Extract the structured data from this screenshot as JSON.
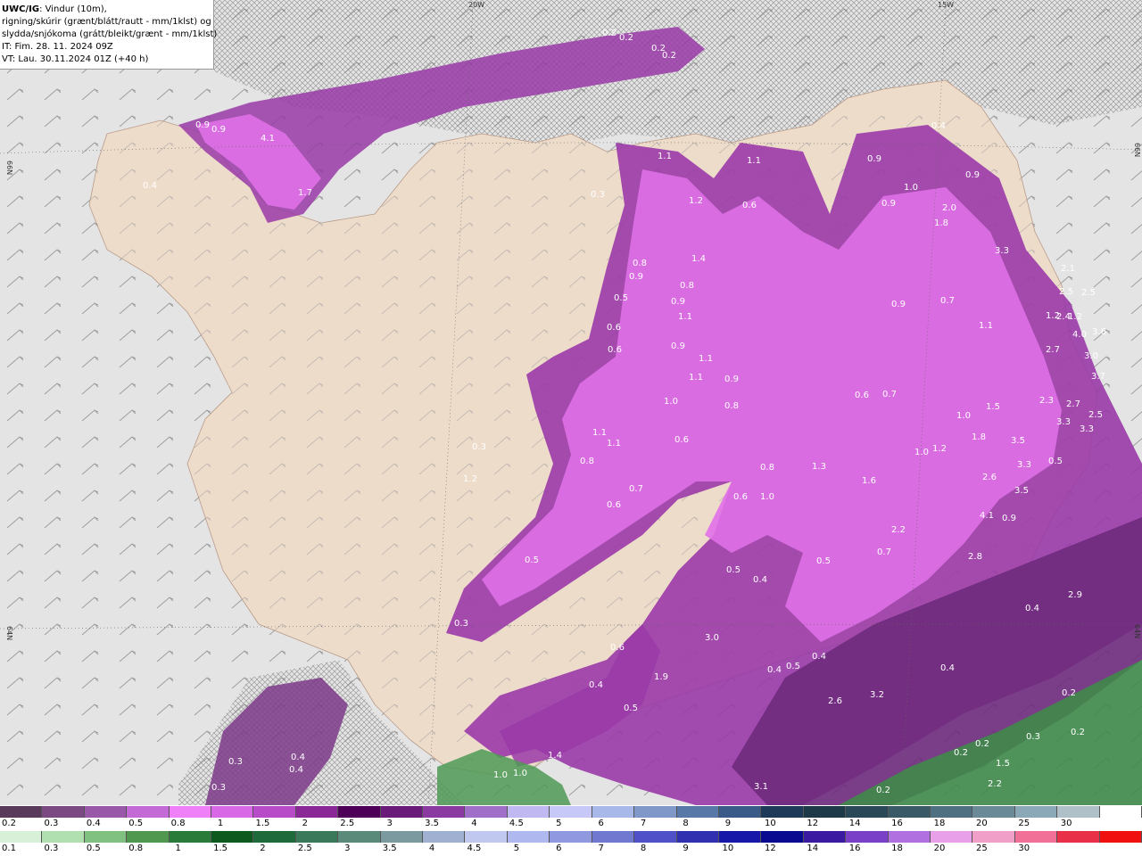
{
  "header": {
    "model": "UWC/IG",
    "desc_1": ": Vindur (10m),",
    "desc_2": "rigning/skúrir (grænt/blátt/rautt - mm/1klst) og",
    "desc_3": "slydda/snjókoma (grátt/bleikt/grænt - mm/1klst)",
    "init_time": "IT: Fim. 28. 11. 2024 09Z",
    "valid_time": "VT: Lau. 30.11.2024 01Z (+40 h)"
  },
  "graticule": {
    "lon_20w": "20W",
    "lon_15w": "15W",
    "lat_66n_left": "66N",
    "lat_66n_right": "66N",
    "lat_64n_left": "64N",
    "lat_64n_right": "64N"
  },
  "colors": {
    "land": "#eedccb",
    "sea": "#d9d9d9",
    "snow_pink": "#e070e8",
    "snow_purple": "#9a3aa8",
    "snow_dark": "#5a1c64",
    "rain_green": "#3f8a4a"
  },
  "precip_labels": [
    {
      "v": "0.2"
    },
    {
      "v": "0.2"
    },
    {
      "v": "0.2"
    },
    {
      "v": "0.2"
    },
    {
      "v": "0.9"
    },
    {
      "v": "0.9"
    },
    {
      "v": "4.1"
    },
    {
      "v": "1.7"
    },
    {
      "v": "0.4"
    },
    {
      "v": "0.4"
    },
    {
      "v": "1.1"
    },
    {
      "v": "1.1"
    },
    {
      "v": "0.9"
    },
    {
      "v": "1.0"
    },
    {
      "v": "0.9"
    },
    {
      "v": "0.3"
    },
    {
      "v": "1.2"
    },
    {
      "v": "0.6"
    },
    {
      "v": "0.9"
    },
    {
      "v": "2.0"
    },
    {
      "v": "1.8"
    },
    {
      "v": "3.3"
    },
    {
      "v": "2.1"
    },
    {
      "v": "2.5"
    },
    {
      "v": "2.5"
    },
    {
      "v": "1.4"
    },
    {
      "v": "0.8"
    },
    {
      "v": "0.9"
    },
    {
      "v": "0.5"
    },
    {
      "v": "0.6"
    },
    {
      "v": "0.6"
    },
    {
      "v": "1.2"
    },
    {
      "v": "1.2"
    },
    {
      "v": "0.9"
    },
    {
      "v": "0.7"
    },
    {
      "v": "1.1"
    },
    {
      "v": "2.4"
    },
    {
      "v": "4.0"
    },
    {
      "v": "3.6"
    },
    {
      "v": "2.7"
    },
    {
      "v": "3.0"
    },
    {
      "v": "3.7"
    },
    {
      "v": "0.9"
    },
    {
      "v": "0.8"
    },
    {
      "v": "1.1"
    },
    {
      "v": "1.1"
    },
    {
      "v": "0.9"
    },
    {
      "v": "0.9"
    },
    {
      "v": "1.0"
    },
    {
      "v": "0.8"
    },
    {
      "v": "1.1"
    },
    {
      "v": "0.6"
    },
    {
      "v": "0.7"
    },
    {
      "v": "1.0"
    },
    {
      "v": "1.5"
    },
    {
      "v": "2.3"
    },
    {
      "v": "2.7"
    },
    {
      "v": "3.3"
    },
    {
      "v": "3.3"
    },
    {
      "v": "2.5"
    },
    {
      "v": "0.3"
    },
    {
      "v": "1.2"
    },
    {
      "v": "1.1"
    },
    {
      "v": "1.1"
    },
    {
      "v": "0.8"
    },
    {
      "v": "0.6"
    },
    {
      "v": "0.8"
    },
    {
      "v": "1.3"
    },
    {
      "v": "1.0"
    },
    {
      "v": "1.2"
    },
    {
      "v": "1.8"
    },
    {
      "v": "3.5"
    },
    {
      "v": "3.3"
    },
    {
      "v": "0.5"
    },
    {
      "v": "0.7"
    },
    {
      "v": "0.6"
    },
    {
      "v": "0.6"
    },
    {
      "v": "1.0"
    },
    {
      "v": "1.6"
    },
    {
      "v": "2.6"
    },
    {
      "v": "3.5"
    },
    {
      "v": "4.1"
    },
    {
      "v": "0.9"
    },
    {
      "v": "0.5"
    },
    {
      "v": "0.5"
    },
    {
      "v": "0.4"
    },
    {
      "v": "0.5"
    },
    {
      "v": "0.7"
    },
    {
      "v": "2.2"
    },
    {
      "v": "2.8"
    },
    {
      "v": "2.9"
    },
    {
      "v": "0.4"
    },
    {
      "v": "0.3"
    },
    {
      "v": "0.6"
    },
    {
      "v": "3.0"
    },
    {
      "v": "0.4"
    },
    {
      "v": "0.4"
    },
    {
      "v": "0.5"
    },
    {
      "v": "1.9"
    },
    {
      "v": "0.4"
    },
    {
      "v": "0.4"
    },
    {
      "v": "0.5"
    },
    {
      "v": "2.6"
    },
    {
      "v": "3.2"
    },
    {
      "v": "1.4"
    },
    {
      "v": "0.3"
    },
    {
      "v": "0.3"
    },
    {
      "v": "0.4"
    },
    {
      "v": "0.4"
    },
    {
      "v": "1.0"
    },
    {
      "v": "1.0"
    },
    {
      "v": "3.1"
    },
    {
      "v": "0.2"
    },
    {
      "v": "0.2"
    },
    {
      "v": "0.2"
    },
    {
      "v": "0.3"
    },
    {
      "v": "0.2"
    },
    {
      "v": "1.5"
    },
    {
      "v": "2.2"
    },
    {
      "v": "0.2"
    }
  ],
  "legend_snow": {
    "colors": [
      "#5a3a5a",
      "#7c4a82",
      "#9a58a8",
      "#c46ad6",
      "#f080f8",
      "#d868e6",
      "#b84cc8",
      "#8a2898",
      "#4e0058",
      "#6a1a78",
      "#8a3aa0",
      "#a070c8",
      "#c0b8f0",
      "#c8c8f8",
      "#a8b8e8",
      "#8098c8",
      "#5878a8",
      "#3a5a88",
      "#1e3a58",
      "#1e3a48",
      "#2a4858",
      "#3a5a68",
      "#4e7080",
      "#6a8a98",
      "#8aa8b8",
      "#b0c0c8",
      "#ffffff"
    ],
    "ticks": [
      "0.2",
      "0.3",
      "0.4",
      "0.5",
      "0.8",
      "1",
      "1.5",
      "2",
      "2.5",
      "3",
      "3.5",
      "4",
      "4.5",
      "5",
      "6",
      "7",
      "8",
      "9",
      "10",
      "12",
      "14",
      "16",
      "18",
      "20",
      "25",
      "30"
    ]
  },
  "legend_rain": {
    "colors": [
      "#d8f0d8",
      "#b0e0b0",
      "#80c080",
      "#509850",
      "#2a7a3a",
      "#0e5a1e",
      "#1e6a3a",
      "#3a7a5a",
      "#5a8a7a",
      "#7a9aa0",
      "#a0b0d0",
      "#c0c8f0",
      "#b0b8f0",
      "#9098e0",
      "#7078d0",
      "#5050c8",
      "#3030b0",
      "#1818a8",
      "#0a0a90",
      "#3a1aa0",
      "#7a40c8",
      "#b070e0",
      "#e8a0e8",
      "#f0a0c8",
      "#f07098",
      "#e83048",
      "#f01010"
    ],
    "ticks": [
      "0.1",
      "0.3",
      "0.5",
      "0.8",
      "1",
      "1.5",
      "2",
      "2.5",
      "3",
      "3.5",
      "4",
      "4.5",
      "5",
      "6",
      "7",
      "8",
      "9",
      "10",
      "12",
      "14",
      "16",
      "18",
      "20",
      "25",
      "30"
    ]
  }
}
